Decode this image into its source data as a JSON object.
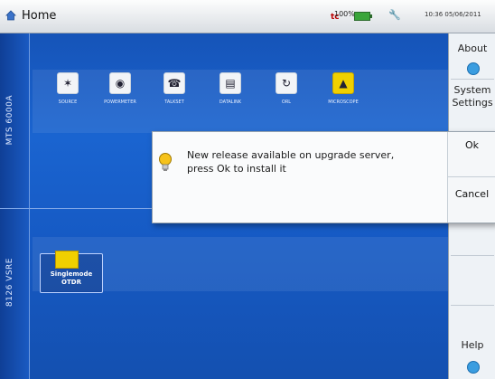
{
  "topbar": {
    "title": "Home",
    "home_icon": "home-icon",
    "battery_percent": "100%",
    "status_badge": "tc",
    "clock": "10:36  05/06/2011"
  },
  "modules": [
    {
      "label": "MTS 6000A",
      "apps": [
        {
          "label": "SOURCE",
          "icon": "source-icon"
        },
        {
          "label": "POWERMETER",
          "icon": "powermeter-icon"
        },
        {
          "label": "TALKSET",
          "icon": "talkset-icon"
        },
        {
          "label": "DATALINK",
          "icon": "datalink-icon"
        },
        {
          "label": "ORL",
          "icon": "orl-icon"
        },
        {
          "label": "MICROSCOPE",
          "icon": "microscope-icon"
        }
      ]
    },
    {
      "label": "8126 VSRE",
      "apps": [
        {
          "label_line1": "Singlemode",
          "label_line2": "OTDR",
          "icon": "otdr-icon"
        }
      ]
    }
  ],
  "right_panel": {
    "about": "About",
    "system_settings_line1": "System",
    "system_settings_line2": "Settings",
    "help": "Help"
  },
  "dialog": {
    "message_line1": "New release available on upgrade server,",
    "message_line2": "press Ok to install it",
    "ok_label": "Ok",
    "cancel_label": "Cancel",
    "icon": "lightbulb-icon"
  },
  "colors": {
    "desktop_blue": "#1a64d0",
    "highlight_yellow": "#f0d000"
  }
}
